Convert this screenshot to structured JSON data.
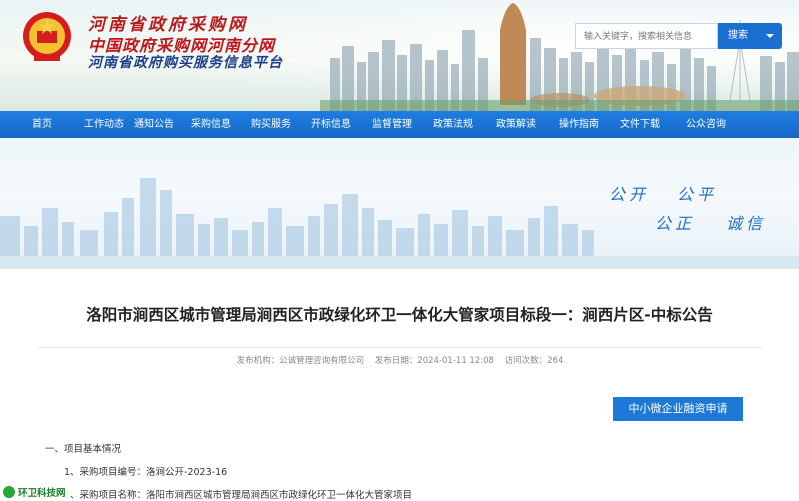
{
  "header": {
    "title_line1": "河南省政府采购网",
    "title_line2": "中国政府采购网河南分网",
    "title_line3": "河南省政府购买服务信息平台",
    "search_placeholder": "输入关键字，搜索相关信息",
    "search_button": "搜索"
  },
  "nav": {
    "items": [
      "首页",
      "工作动态",
      "通知公告",
      "采购信息",
      "购买服务",
      "开标信息",
      "监督管理",
      "政策法规",
      "政策解读",
      "操作指南",
      "文件下载",
      "公众咨询"
    ]
  },
  "banner": {
    "slogan1": "公开",
    "slogan2": "公平",
    "slogan3": "公正",
    "slogan4": "诚信"
  },
  "article": {
    "title": "洛阳市涧西区城市管理局涧西区市政绿化环卫一体化大管家项目标段一：涧西片区-中标公告",
    "publisher": "发布机构：公诚管理咨询有限公司",
    "date": "发布日期：2024-01-11 12:08",
    "views": "访问次数：264",
    "finance_button": "中小微企业融资申请",
    "section1": "一、项目基本情况",
    "item1": "1、采购项目编号：洛涧公开-2023-16",
    "item2": "2、采购项目名称：洛阳市涧西区城市管理局涧西区市政绿化环卫一体化大管家项目"
  },
  "watermark": {
    "text": "环卫科技网"
  },
  "colors": {
    "nav": "#1a73d6",
    "accent": "#1e78d6",
    "title_red": "#b71c1c"
  }
}
